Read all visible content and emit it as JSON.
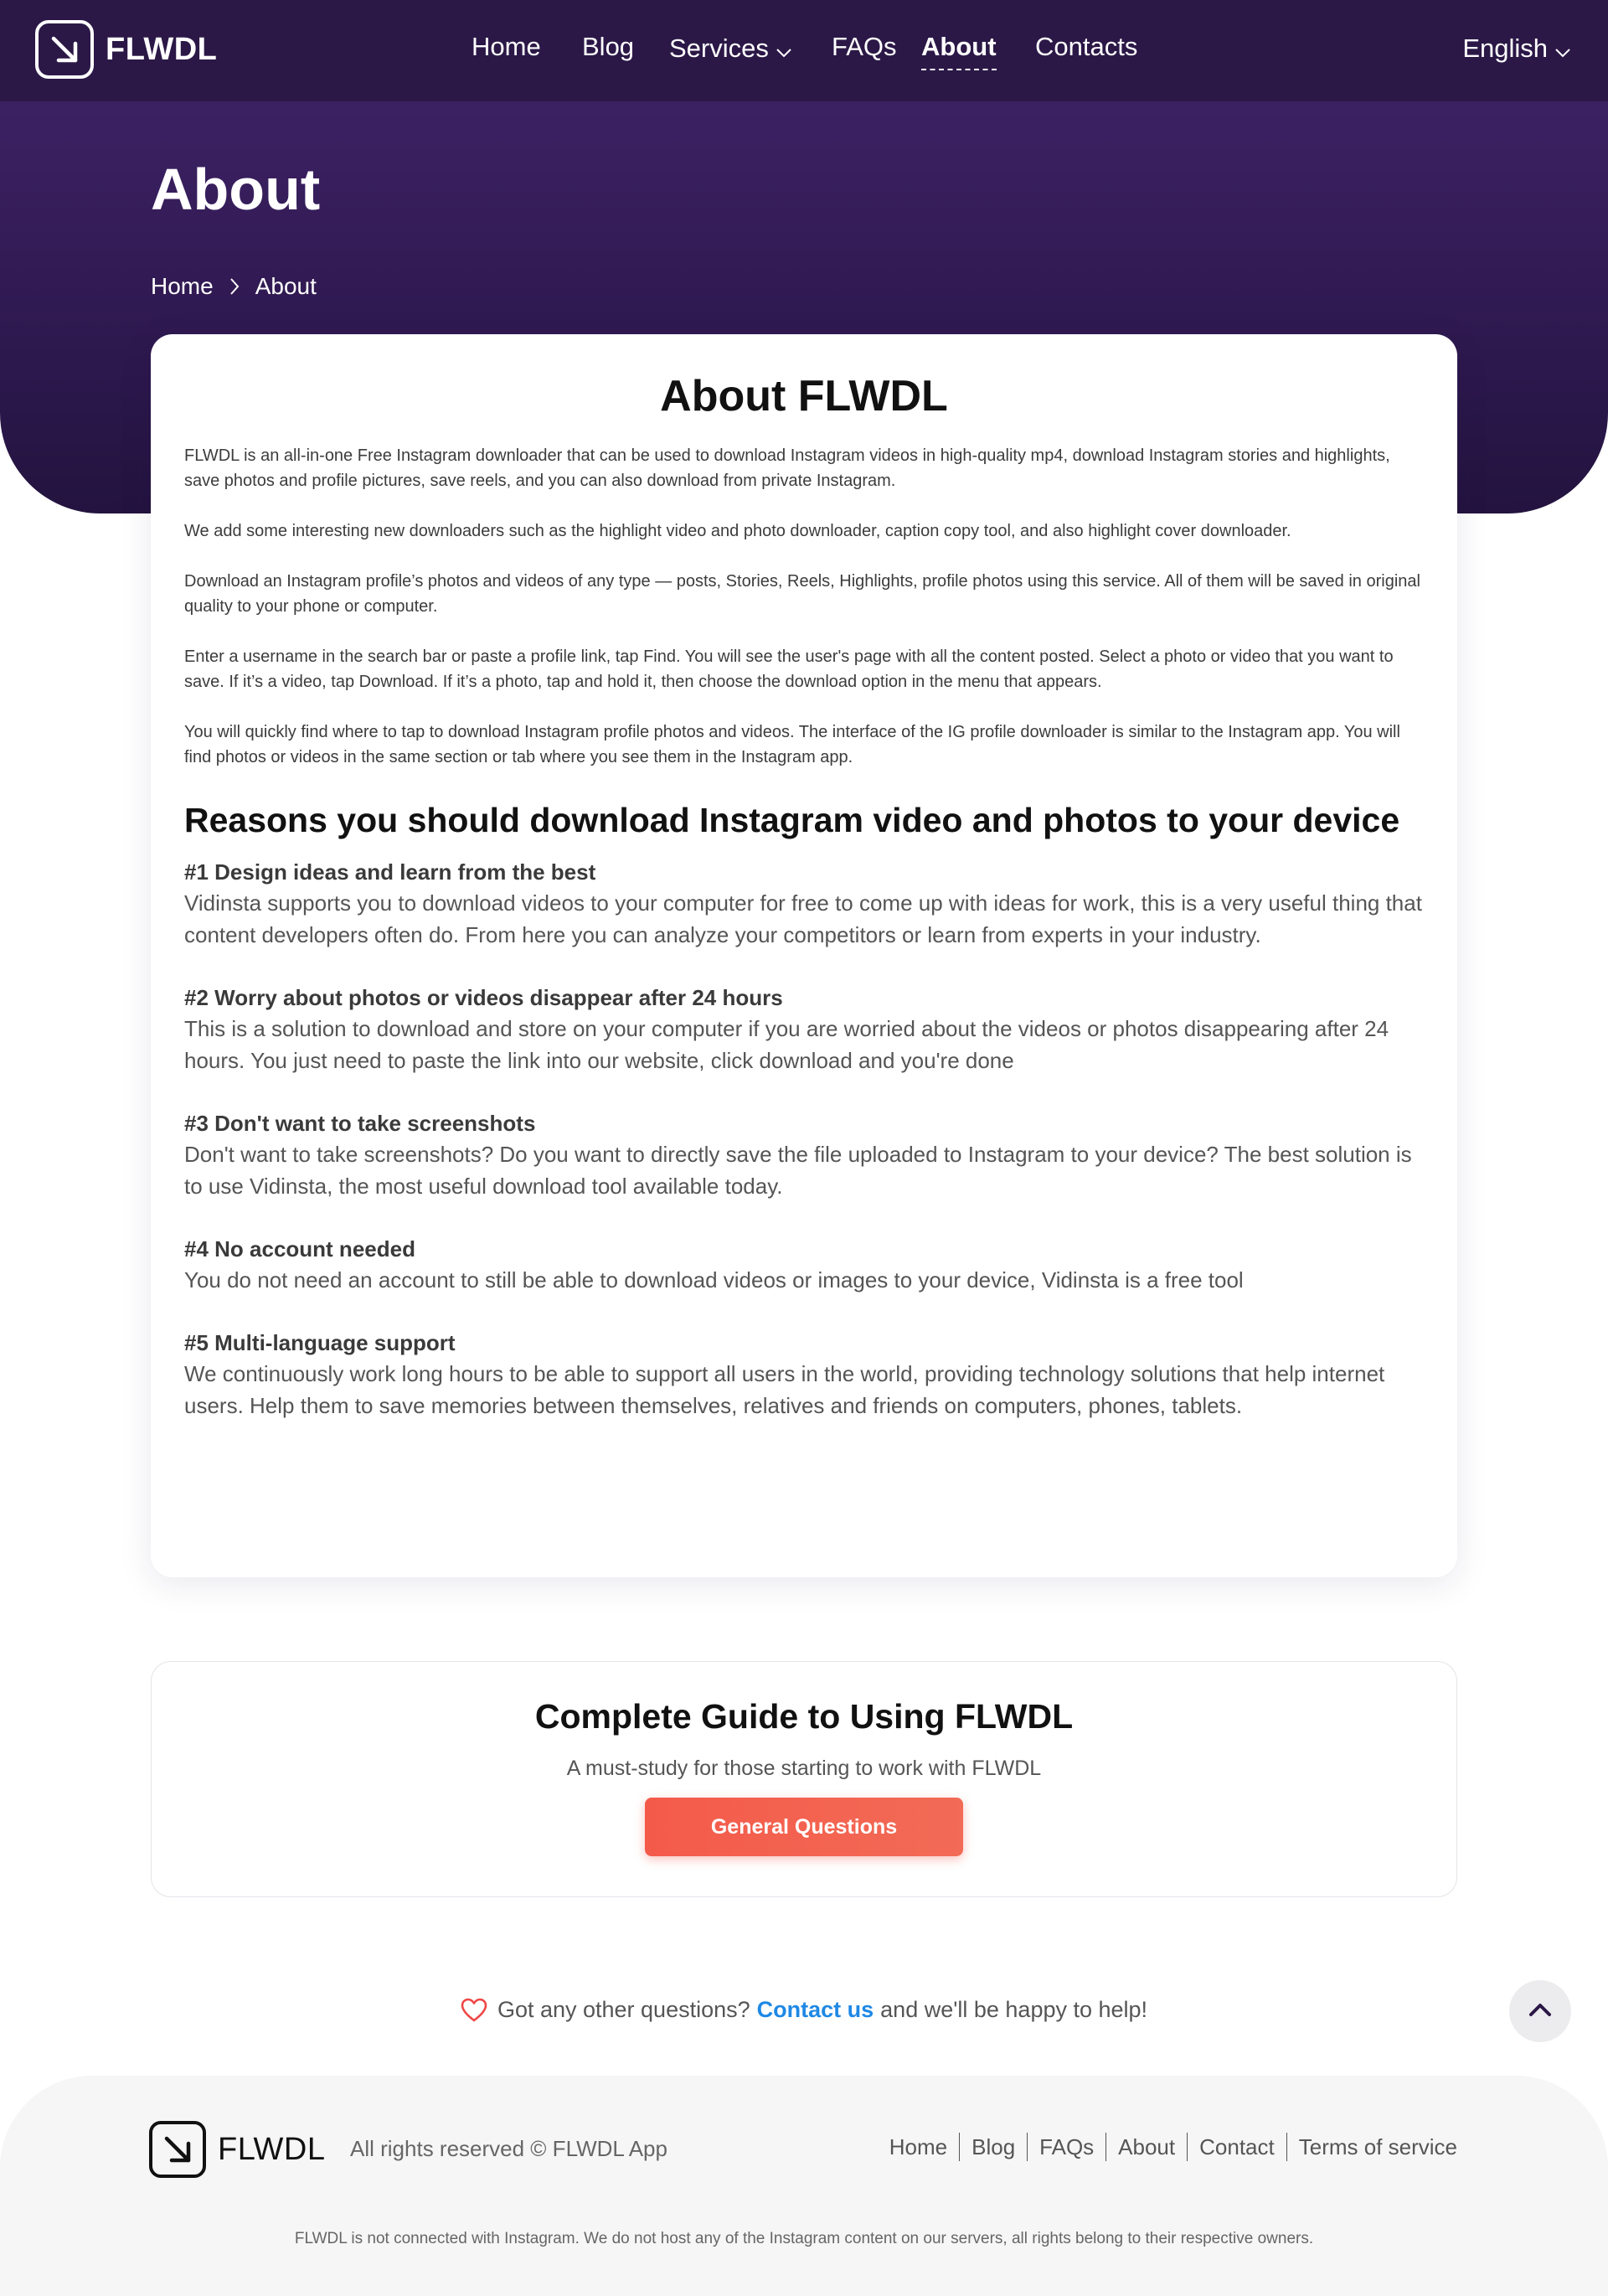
{
  "brand": {
    "name": "FLWDL"
  },
  "nav": {
    "items": [
      {
        "label": "Home"
      },
      {
        "label": "Blog"
      },
      {
        "label": "Services"
      },
      {
        "label": "FAQs"
      },
      {
        "label": "About"
      },
      {
        "label": "Contacts"
      }
    ],
    "active": "About",
    "language": "English"
  },
  "hero": {
    "title": "About",
    "breadcrumb": [
      "Home",
      "About"
    ]
  },
  "about": {
    "heading": "About FLWDL",
    "paragraphs": [
      "FLWDL is an all-in-one Free Instagram downloader that can be used to download Instagram videos in high-quality mp4, download Instagram stories and highlights, save photos and profile pictures, save reels, and you can also download from private Instagram.",
      "We add some interesting new downloaders such as the highlight video and photo downloader, caption copy tool, and also highlight cover downloader.",
      "Download an Instagram profile’s photos and videos of any type — posts, Stories, Reels, Highlights, profile photos using this service. All of them will be saved in original quality to your phone or computer.",
      "Enter a username in the search bar or paste a profile link, tap Find. You will see the user's page with all the content posted. Select a photo or video that you want to save. If it’s a video, tap Download. If it’s a photo, tap and hold it, then choose the download option in the menu that appears.",
      "You will quickly find where to tap to download Instagram profile photos and videos. The interface of the IG profile downloader is similar to the Instagram app. You will find photos or videos in the same section or tab where you see them in the Instagram app."
    ],
    "reasons_heading": "Reasons you should download Instagram video and photos to your device",
    "reasons": [
      {
        "title": "#1 Design ideas and learn from the best",
        "text": "Vidinsta supports you to download videos to your computer for free to come up with ideas for work, this is a very useful thing that content developers often do. From here you can analyze your competitors or learn from experts in your industry."
      },
      {
        "title": "#2 Worry about photos or videos disappear after 24 hours",
        "text": "This is a solution to download and store on your computer if you are worried about the videos or photos disappearing after 24 hours. You just need to paste the link into our website, click download and you're done"
      },
      {
        "title": "#3 Don't want to take screenshots",
        "text": "Don't want to take screenshots? Do you want to directly save the file uploaded to Instagram to your device? The best solution is to use Vidinsta, the most useful download tool available today."
      },
      {
        "title": "#4 No account needed",
        "text": "You do not need an account to still be able to download videos or images to your device, Vidinsta is a free tool"
      },
      {
        "title": "#5 Multi-language support",
        "text": "We continuously work long hours to be able to support all users in the world, providing technology solutions that help internet users. Help them to save memories between themselves, relatives and friends on computers, phones, tablets."
      }
    ]
  },
  "guide": {
    "heading": "Complete Guide to Using FLWDL",
    "subtitle": "A must-study for those starting to work with FLWDL",
    "button": "General Questions"
  },
  "questions": {
    "prefix": "Got any other questions?",
    "link": "Contact us",
    "suffix": "and we'll be happy to help!"
  },
  "footer": {
    "rights": "All rights reserved © FLWDL App",
    "links": [
      "Home",
      "Blog",
      "FAQs",
      "About",
      "Contact",
      "Terms of service"
    ],
    "disclaimer": "FLWDL is not connected with Instagram. We do not host any of the Instagram content on our servers, all rights belong to their respective owners."
  },
  "colors": {
    "header": "#2b1847",
    "hero": "#3e2265",
    "accent_button": "#f45a4a",
    "link": "#1e88e5"
  },
  "icons": [
    "logo-arrow-icon",
    "chevron-down-icon",
    "chevron-right-icon",
    "heart-icon",
    "chevron-up-icon"
  ]
}
